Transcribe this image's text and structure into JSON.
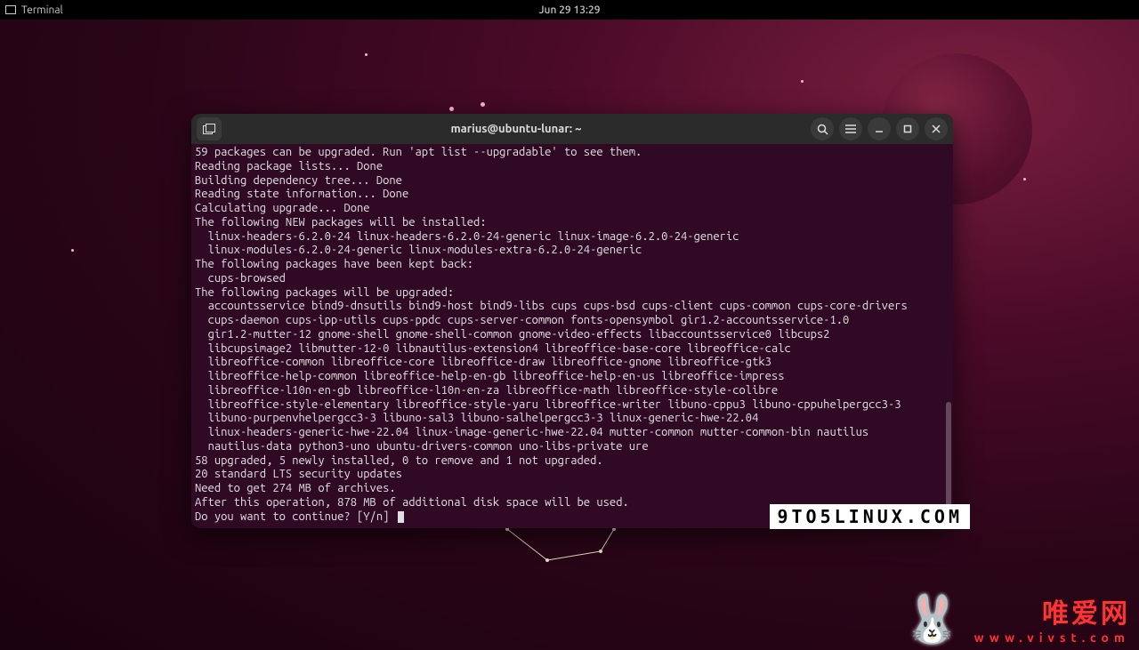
{
  "topbar": {
    "app_name": "Terminal",
    "clock": "Jun 29  13:29"
  },
  "window": {
    "title": "marius@ubuntu-lunar: ~"
  },
  "terminal": {
    "lines": [
      "59 packages can be upgraded. Run 'apt list --upgradable' to see them.",
      "Reading package lists... Done",
      "Building dependency tree... Done",
      "Reading state information... Done",
      "Calculating upgrade... Done",
      "The following NEW packages will be installed:",
      "  linux-headers-6.2.0-24 linux-headers-6.2.0-24-generic linux-image-6.2.0-24-generic",
      "  linux-modules-6.2.0-24-generic linux-modules-extra-6.2.0-24-generic",
      "The following packages have been kept back:",
      "  cups-browsed",
      "The following packages will be upgraded:",
      "  accountsservice bind9-dnsutils bind9-host bind9-libs cups cups-bsd cups-client cups-common cups-core-drivers",
      "  cups-daemon cups-ipp-utils cups-ppdc cups-server-common fonts-opensymbol gir1.2-accountsservice-1.0",
      "  gir1.2-mutter-12 gnome-shell gnome-shell-common gnome-video-effects libaccountsservice0 libcups2",
      "  libcupsimage2 libmutter-12-0 libnautilus-extension4 libreoffice-base-core libreoffice-calc",
      "  libreoffice-common libreoffice-core libreoffice-draw libreoffice-gnome libreoffice-gtk3",
      "  libreoffice-help-common libreoffice-help-en-gb libreoffice-help-en-us libreoffice-impress",
      "  libreoffice-l10n-en-gb libreoffice-l10n-en-za libreoffice-math libreoffice-style-colibre",
      "  libreoffice-style-elementary libreoffice-style-yaru libreoffice-writer libuno-cppu3 libuno-cppuhelpergcc3-3",
      "  libuno-purpenvhelpergcc3-3 libuno-sal3 libuno-salhelpergcc3-3 linux-generic-hwe-22.04",
      "  linux-headers-generic-hwe-22.04 linux-image-generic-hwe-22.04 mutter-common mutter-common-bin nautilus",
      "  nautilus-data python3-uno ubuntu-drivers-common uno-libs-private ure",
      "58 upgraded, 5 newly installed, 0 to remove and 1 not upgraded.",
      "20 standard LTS security updates",
      "Need to get 274 MB of archives.",
      "After this operation, 878 MB of additional disk space will be used."
    ],
    "prompt": "Do you want to continue? [Y/n] "
  },
  "watermark": {
    "site1": "9TO5LINUX.COM",
    "site2_cn": "唯爱网",
    "site2_url": "www.vivst.com"
  }
}
